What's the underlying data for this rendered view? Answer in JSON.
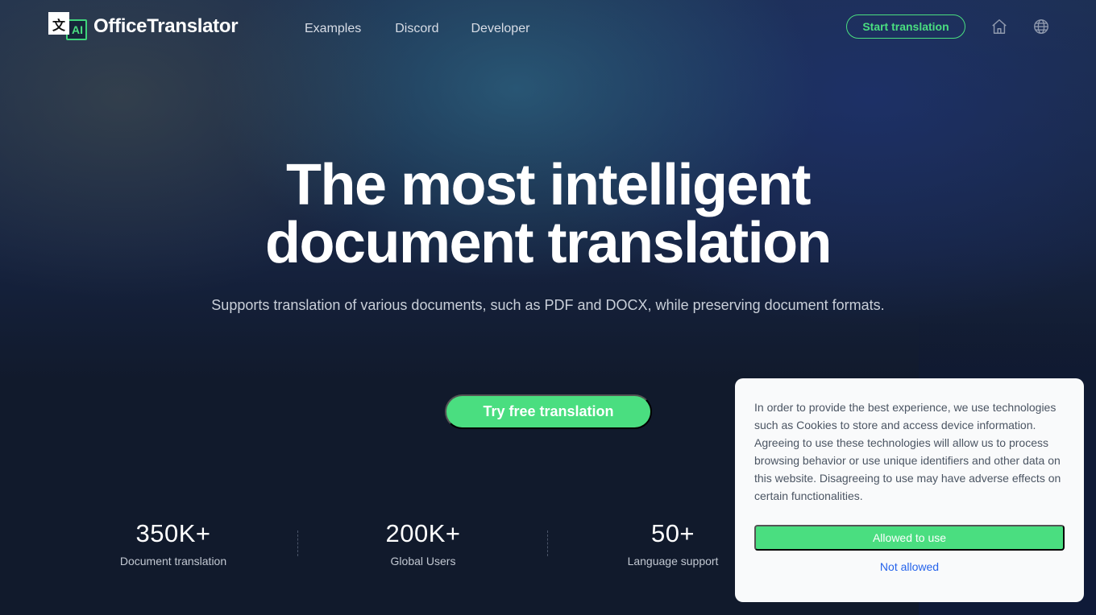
{
  "brand": {
    "name": "OfficeTranslator",
    "icon_glyph_left": "文",
    "icon_glyph_right": "AI"
  },
  "nav": {
    "items": [
      {
        "label": "Examples"
      },
      {
        "label": "Discord"
      },
      {
        "label": "Developer"
      }
    ]
  },
  "header_actions": {
    "start_label": "Start translation",
    "home_icon": "home-icon",
    "language_icon": "globe-icon"
  },
  "hero": {
    "title_line1": "The most intelligent",
    "title_line2": "document translation",
    "subtitle": "Supports translation of various documents, such as PDF and DOCX, while preserving document formats.",
    "cta_label": "Try free translation"
  },
  "stats": [
    {
      "value": "350K+",
      "label": "Document translation"
    },
    {
      "value": "200K+",
      "label": "Global Users"
    },
    {
      "value": "50+",
      "label": "Language support"
    }
  ],
  "cookie_banner": {
    "text": "In order to provide the best experience, we use technologies such as Cookies to store and access device information. Agreeing to use these technologies will allow us to process browsing behavior or use unique identifiers and other data on this website. Disagreeing to use may have adverse effects on certain functionalities.",
    "allow_label": "Allowed to use",
    "deny_label": "Not allowed"
  },
  "colors": {
    "accent": "#4ade80",
    "background": "#111a2c",
    "link": "#2563eb"
  }
}
